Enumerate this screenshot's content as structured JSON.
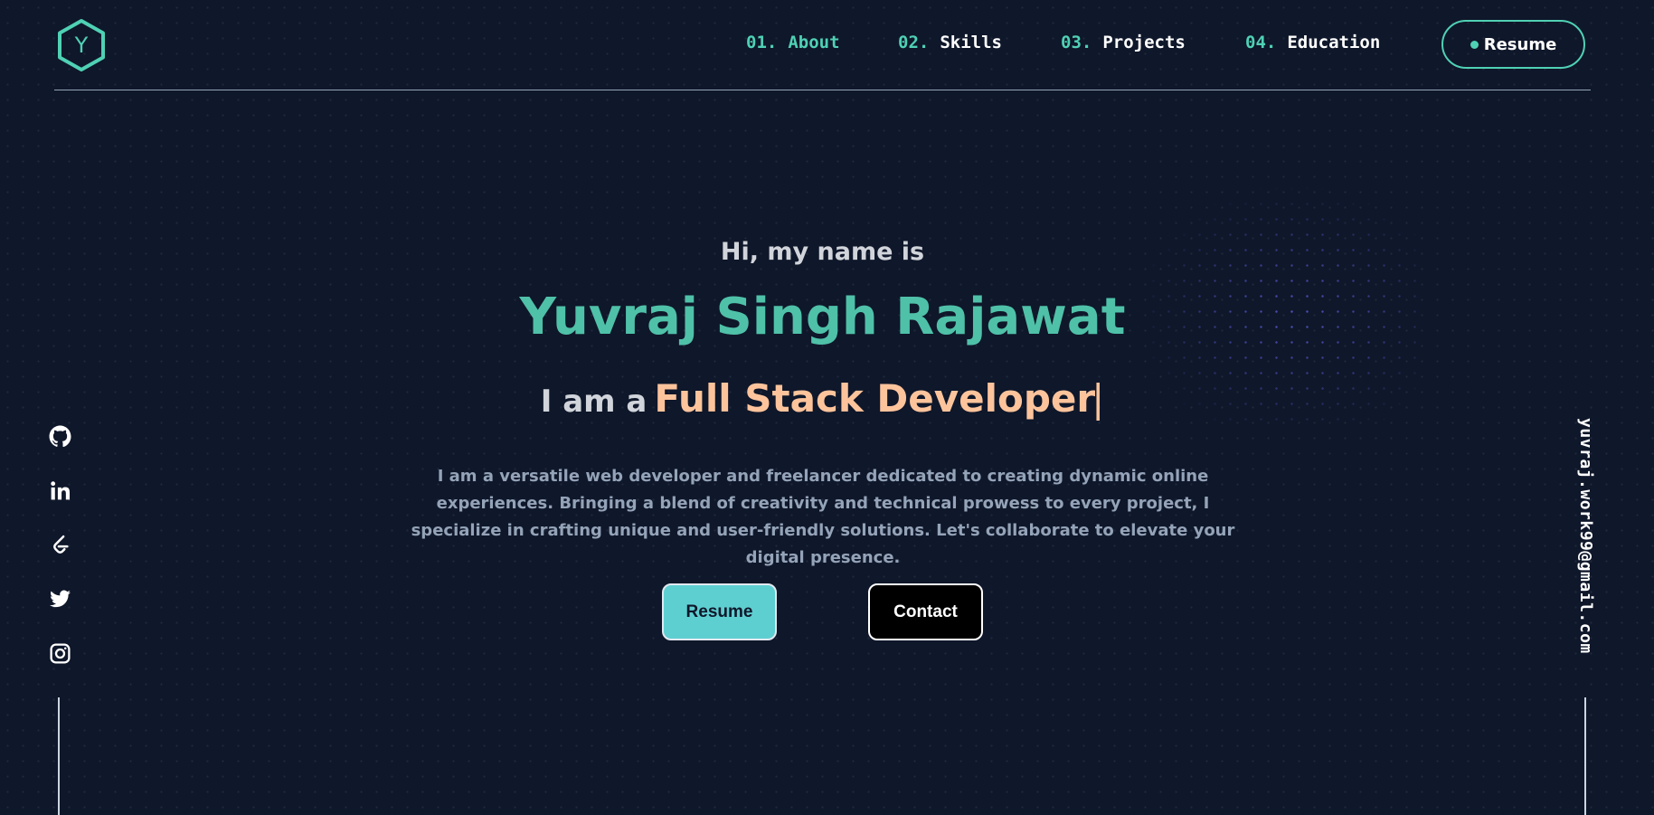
{
  "header": {
    "logo_letter": "Y",
    "nav": [
      {
        "num": "01.",
        "label": "About"
      },
      {
        "num": "02.",
        "label": "Skills"
      },
      {
        "num": "03.",
        "label": "Projects"
      },
      {
        "num": "04.",
        "label": "Education"
      }
    ],
    "resume_label": "Resume"
  },
  "hero": {
    "greeting": "Hi, my name is",
    "name": "Yuvraj Singh Rajawat",
    "role_prefix": "I am a",
    "role": "Full Stack Developer",
    "cursor": "|",
    "description": "I am a versatile web developer and freelancer dedicated to creating dynamic online experiences. Bringing a blend of creativity and technical prowess to every project, I specialize in crafting unique and user-friendly solutions. Let's collaborate to elevate your digital presence."
  },
  "buttons": {
    "resume": "Resume",
    "contact": "Contact"
  },
  "social": [
    {
      "icon": "github-icon"
    },
    {
      "icon": "linkedin-icon"
    },
    {
      "icon": "leetcode-icon"
    },
    {
      "icon": "twitter-icon"
    },
    {
      "icon": "instagram-icon"
    }
  ],
  "email": "yuvraj.work99@gmail.com",
  "colors": {
    "background": "#0f172a",
    "accent": "#4fd1b4",
    "name": "#4fc1a8",
    "role": "#fdc49c",
    "resume_button": "#5ecfd1",
    "muted_text": "#94a3b8"
  }
}
